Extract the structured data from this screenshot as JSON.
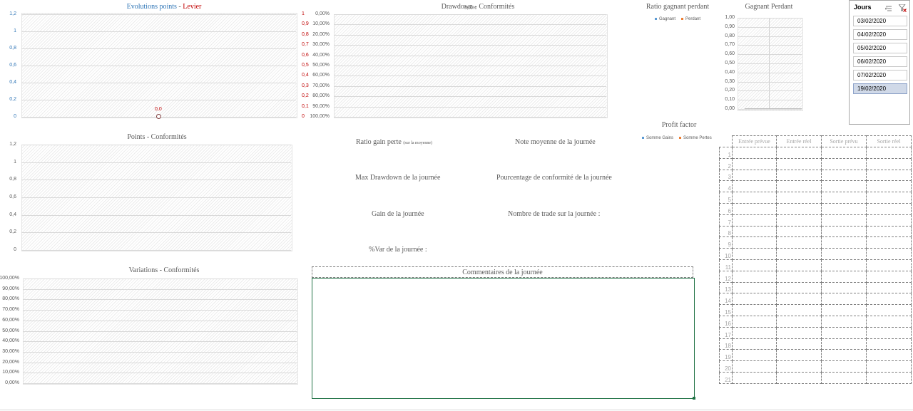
{
  "charts": {
    "evolution": {
      "title_part1": "Evolutions points",
      "title_sep": " - ",
      "title_part2": "Levier",
      "left_ticks": [
        "1,2",
        "1",
        "0,8",
        "0,6",
        "0,4",
        "0,2",
        "0"
      ],
      "right_ticks": [
        "1",
        "0,9",
        "0,8",
        "0,7",
        "0,6",
        "0,5",
        "0,4",
        "0,3",
        "0,2",
        "0,1",
        "0"
      ],
      "point_label": "0,0"
    },
    "drawdown": {
      "title": "Drawdown - Conformités",
      "overlap_label": "0,00%",
      "ticks": [
        "0,00%",
        "10,00%",
        "20,00%",
        "30,00%",
        "40,00%",
        "50,00%",
        "60,00%",
        "70,00%",
        "80,00%",
        "90,00%",
        "100,00%"
      ]
    },
    "ratio": {
      "title": "Ratio gagnant perdant",
      "legend": [
        {
          "label": "Gagnant",
          "color": "#5b9bd5"
        },
        {
          "label": "Perdant",
          "color": "#ed7d31"
        }
      ]
    },
    "gagnant": {
      "title": "Gagnant Perdant",
      "ticks": [
        "1,00",
        "0,90",
        "0,80",
        "0,70",
        "0,60",
        "0,50",
        "0,40",
        "0,30",
        "0,20",
        "0,10",
        "0,00"
      ]
    },
    "points": {
      "title": "Points - Conformités",
      "ticks": [
        "1,2",
        "1",
        "0,8",
        "0,6",
        "0,4",
        "0,2",
        "0"
      ]
    },
    "variations": {
      "title": "Variations - Conformités",
      "ticks": [
        "100,00%",
        "90,00%",
        "80,00%",
        "70,00%",
        "60,00%",
        "50,00%",
        "40,00%",
        "30,00%",
        "20,00%",
        "10,00%",
        "0,00%"
      ]
    },
    "profit": {
      "title": "Profit factor",
      "legend": [
        {
          "label": "Somme Gains",
          "color": "#5b9bd5"
        },
        {
          "label": "Somme Pertes",
          "color": "#ed7d31"
        }
      ]
    }
  },
  "kpis": {
    "ratio_gain_perte": "Ratio gain perte",
    "ratio_gain_perte_note": "(sur la moyenne)",
    "note_moyenne": "Note moyenne de la journée",
    "max_drawdown": "Max Drawdown de la journée",
    "pourcentage_conformite": "Pourcentage de conformité de la journée",
    "gain_journee": "Gain de la journée",
    "nombre_trade": "Nombre de trade sur la journée :",
    "var_journee": "%Var de la journée :"
  },
  "comments": {
    "title": "Commentaires de la journée",
    "value": ""
  },
  "slicer": {
    "title": "Jours",
    "items": [
      {
        "label": "03/02/2020",
        "selected": false
      },
      {
        "label": "04/02/2020",
        "selected": false
      },
      {
        "label": "05/02/2020",
        "selected": false
      },
      {
        "label": "06/02/2020",
        "selected": false
      },
      {
        "label": "07/02/2020",
        "selected": false
      },
      {
        "label": "19/02/2020",
        "selected": true
      }
    ]
  },
  "trades": {
    "headers": [
      "Entrée prévue",
      "Entrée réel",
      "Sortie prévu",
      "Sortie réel"
    ],
    "row_numbers": [
      "1",
      "2",
      "3",
      "4",
      "5",
      "6",
      "7",
      "8",
      "9",
      "10",
      "11",
      "12",
      "13",
      "14",
      "15",
      "16",
      "17",
      "18",
      "19",
      "20",
      "21"
    ]
  }
}
